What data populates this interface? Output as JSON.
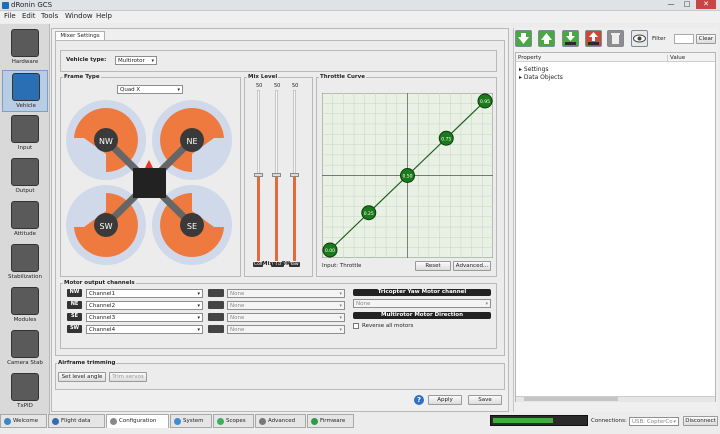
{
  "window": {
    "title": "dRonin GCS",
    "min": "—",
    "max": "□",
    "close": "✕"
  },
  "menu": [
    "File",
    "Edit",
    "Tools",
    "Window",
    "Help"
  ],
  "sidebar": [
    {
      "label": "Hardware",
      "icon": "hardware-icon"
    },
    {
      "label": "Vehicle",
      "icon": "vehicle-icon"
    },
    {
      "label": "Input",
      "icon": "input-icon"
    },
    {
      "label": "Output",
      "icon": "output-icon"
    },
    {
      "label": "Attitude",
      "icon": "attitude-icon"
    },
    {
      "label": "Stabilization",
      "icon": "stabilization-icon"
    },
    {
      "label": "Modules",
      "icon": "modules-icon"
    },
    {
      "label": "Camera Stab",
      "icon": "camera-icon"
    },
    {
      "label": "TxPID",
      "icon": "txpid-icon"
    }
  ],
  "mixer_tab": "Mixer Settings",
  "vehicle_type": {
    "label": "Vehicle type:",
    "value": "Multirotor"
  },
  "frame": {
    "label": "Frame Type",
    "value": "Quad X",
    "motors": [
      "NW",
      "NE",
      "SW",
      "SE"
    ]
  },
  "mix": {
    "label": "Mix Level",
    "values": [
      "50",
      "50",
      "50"
    ],
    "bottoms": [
      "Coll",
      "Pitch",
      "Yaw"
    ],
    "ok": "Mixer OK",
    "fills": [
      0.5,
      0.5,
      0.5
    ]
  },
  "throttle": {
    "label": "Throttle Curve",
    "points": [
      {
        "x": 0,
        "y": 0
      },
      {
        "x": 0.25,
        "y": 0.25
      },
      {
        "x": 0.5,
        "y": 0.5
      },
      {
        "x": 0.75,
        "y": 0.75
      },
      {
        "x": 1,
        "y": 1
      }
    ],
    "labels": [
      "0.00",
      "0.25",
      "0.50",
      "0.75",
      "0.95"
    ],
    "input": "Input: Throttle",
    "reset": "Reset",
    "advanced": "Advanced..."
  },
  "motor_output": {
    "label": "Motor output channels",
    "rows": [
      {
        "m": "NW",
        "ch": "Channel1",
        "extra": "None"
      },
      {
        "m": "NE",
        "ch": "Channel2",
        "extra": "None"
      },
      {
        "m": "SE",
        "ch": "Channel3",
        "extra": "None"
      },
      {
        "m": "SW",
        "ch": "Channel4",
        "extra": "None"
      }
    ]
  },
  "tricopter": {
    "label": "Tricopter Yaw Motor channel",
    "value": "None"
  },
  "multirotor": {
    "label": "Multirotor Motor Direction",
    "reverse": "Reverse all motors"
  },
  "trim": {
    "label": "Airframe trimming",
    "set_level": "Set level angle",
    "trim_servos": "Trim servos"
  },
  "actions": {
    "help": "?",
    "apply": "Apply",
    "save": "Save"
  },
  "right": {
    "filter": "Filter",
    "clear": "Clear",
    "col_property": "Property",
    "col_value": "Value",
    "tree": [
      "Settings",
      "Data Objects"
    ]
  },
  "tabs": [
    {
      "label": "Welcome",
      "c": "#3a86c8"
    },
    {
      "label": "Flight data",
      "c": "#2f6fb0"
    },
    {
      "label": "Configuration",
      "c": "#888"
    },
    {
      "label": "System",
      "c": "#3c8dd4"
    },
    {
      "label": "Scopes",
      "c": "#3cae5f"
    },
    {
      "label": "Advanced",
      "c": "#777"
    },
    {
      "label": "Firmware",
      "c": "#2e9b47"
    }
  ],
  "status": {
    "connections": "Connections:",
    "port": "USB: CopterCo",
    "disconnect": "Disconnect"
  }
}
